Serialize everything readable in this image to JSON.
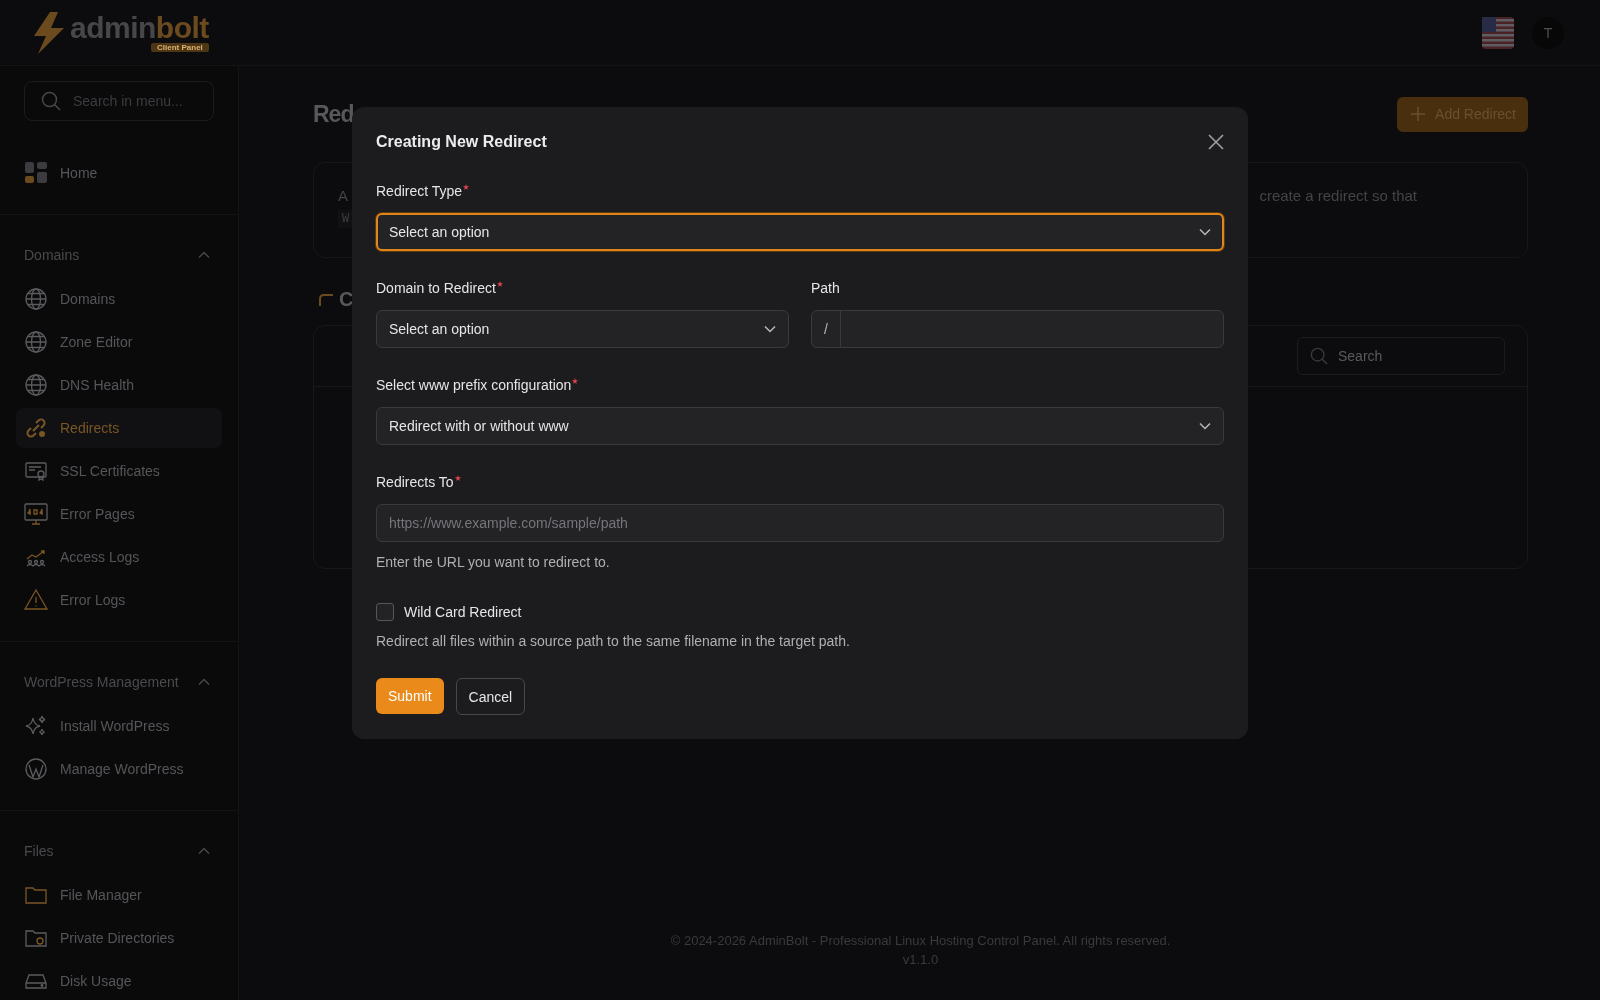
{
  "header": {
    "logo": {
      "word_a": "admin",
      "word_b": "bolt",
      "badge": "Client Panel"
    },
    "avatar": "T"
  },
  "sidebar": {
    "search": {
      "placeholder": "Search in menu..."
    },
    "home": {
      "label": "Home",
      "selected": false
    },
    "sections": [
      {
        "title": "Domains",
        "expanded": true,
        "items": [
          {
            "label": "Domains",
            "selected": false
          },
          {
            "label": "Zone Editor",
            "selected": false
          },
          {
            "label": "DNS Health",
            "selected": false
          },
          {
            "label": "Redirects",
            "selected": true
          },
          {
            "label": "SSL Certificates",
            "selected": false
          },
          {
            "label": "Error Pages",
            "selected": false
          },
          {
            "label": "Access Logs",
            "selected": false
          },
          {
            "label": "Error Logs",
            "selected": false
          }
        ]
      },
      {
        "title": "WordPress Management",
        "expanded": true,
        "items": [
          {
            "label": "Install WordPress",
            "selected": false
          },
          {
            "label": "Manage WordPress",
            "selected": false
          }
        ]
      },
      {
        "title": "Files",
        "expanded": true,
        "items": [
          {
            "label": "File Manager",
            "selected": false
          },
          {
            "label": "Private Directories",
            "selected": false
          },
          {
            "label": "Disk Usage",
            "selected": false
          }
        ]
      }
    ]
  },
  "page": {
    "title": "Red",
    "add_button": "Add Redirect",
    "info_left": "A",
    "info_code": "W",
    "info_right": "create a redirect so that",
    "section_heading": "C",
    "table_search": {
      "placeholder": "Search"
    }
  },
  "modal": {
    "title": "Creating New Redirect",
    "redirect_type": {
      "label": "Redirect Type",
      "required": true,
      "value": "Select an option",
      "focused": true
    },
    "domain": {
      "label": "Domain to Redirect",
      "required": true,
      "value": "Select an option",
      "focused": false
    },
    "path": {
      "label": "Path",
      "prefix": "/"
    },
    "www": {
      "label": "Select www prefix configuration",
      "required": true,
      "value": "Redirect with or without www",
      "focused": false
    },
    "redirects_to": {
      "label": "Redirects To",
      "required": true,
      "placeholder": "https://www.example.com/sample/path",
      "help": "Enter the URL you want to redirect to."
    },
    "wildcard": {
      "label": "Wild Card Redirect",
      "checked": false,
      "help": "Redirect all files within a source path to the same filename in the target path."
    },
    "submit": "Submit",
    "cancel": "Cancel"
  },
  "footer": {
    "copyright": "© 2024-2026 AdminBolt - Professional Linux Hosting Control Panel. All rights reserved.",
    "version": "v1.1.0"
  }
}
